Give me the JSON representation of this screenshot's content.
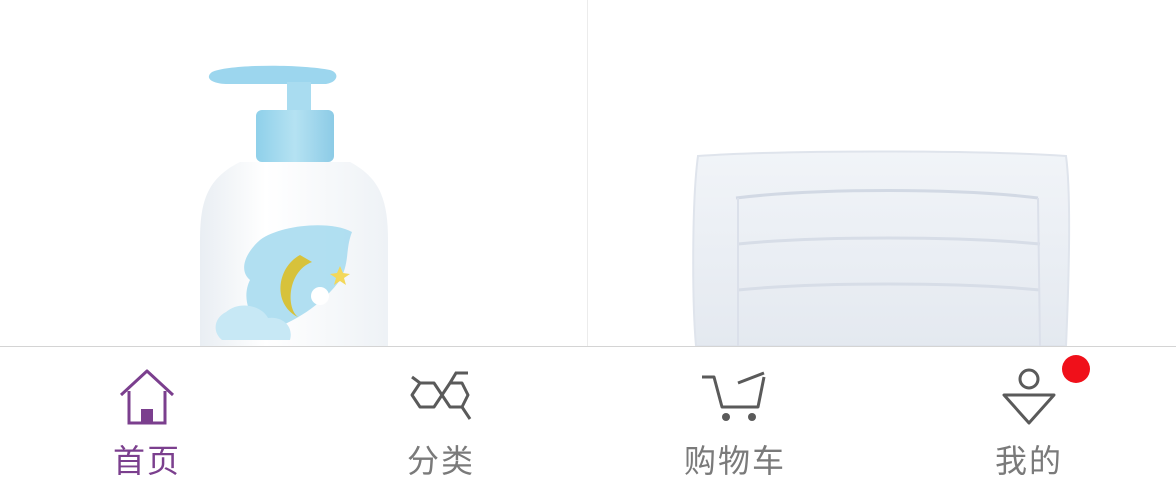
{
  "tabbar": {
    "items": [
      {
        "label": "首页",
        "icon": "home-icon",
        "active": true
      },
      {
        "label": "分类",
        "icon": "category-icon",
        "active": false
      },
      {
        "label": "购物车",
        "icon": "cart-icon",
        "active": false
      },
      {
        "label": "我的",
        "icon": "profile-icon",
        "active": false,
        "has_badge": true
      }
    ]
  },
  "colors": {
    "active": "#7b3f8e",
    "inactive": "#7a7a7a",
    "badge": "#f0101a"
  }
}
